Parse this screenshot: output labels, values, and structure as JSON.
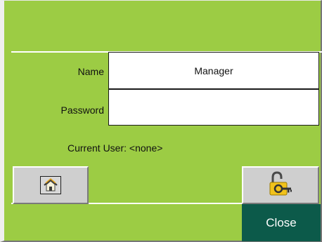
{
  "login": {
    "name_label": "Name",
    "name_value": "Manager",
    "password_label": "Password",
    "password_value": "",
    "current_user_text": "Current User: <none>"
  },
  "buttons": {
    "home_icon": "home-icon",
    "login_icon": "padlock-key-icon",
    "close_label": "Close"
  },
  "colors": {
    "background": "#9ccc44",
    "close_button": "#0c5a4a",
    "button_face": "#cfcfcf"
  }
}
